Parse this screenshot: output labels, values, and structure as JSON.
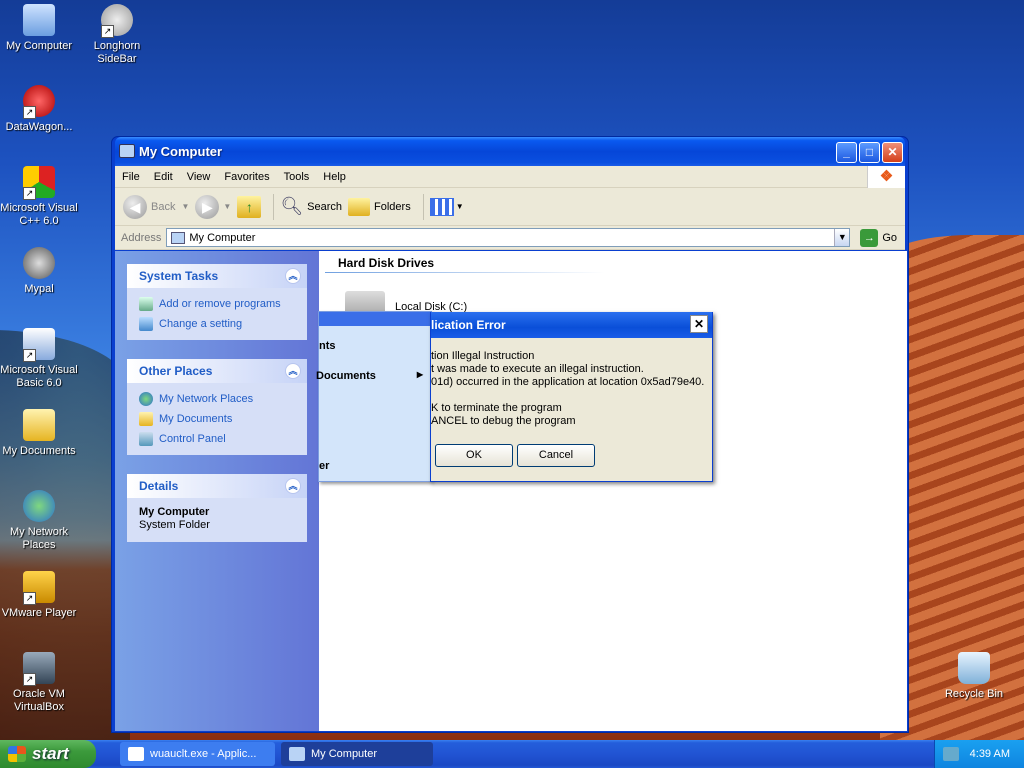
{
  "desktop": {
    "icons": [
      {
        "label": "My Computer",
        "icon": "computer-icon"
      },
      {
        "label": "Longhorn SideBar",
        "icon": "sidebar-icon"
      },
      {
        "label": "DataWagon...",
        "icon": "datawagon-icon"
      },
      {
        "label": "Microsoft Visual C++ 6.0",
        "icon": "visual-cpp-icon"
      },
      {
        "label": "Mypal",
        "icon": "mypal-icon"
      },
      {
        "label": "Microsoft Visual Basic 6.0",
        "icon": "visual-basic-icon"
      },
      {
        "label": "My Documents",
        "icon": "documents-folder-icon"
      },
      {
        "label": "My Network Places",
        "icon": "network-places-icon"
      },
      {
        "label": "VMware Player",
        "icon": "vmware-icon"
      },
      {
        "label": "Oracle VM VirtualBox",
        "icon": "virtualbox-icon"
      },
      {
        "label": "Recycle Bin",
        "icon": "recycle-bin-icon"
      }
    ]
  },
  "window": {
    "title": "My Computer",
    "menu": [
      "File",
      "Edit",
      "View",
      "Favorites",
      "Tools",
      "Help"
    ],
    "toolbar": {
      "back": "Back",
      "search": "Search",
      "folders": "Folders"
    },
    "address": {
      "label": "Address",
      "value": "My Computer",
      "go": "Go"
    },
    "tasks": {
      "system_title": "System Tasks",
      "system_items": [
        "Add or remove programs",
        "Change a setting"
      ],
      "other_title": "Other Places",
      "other_items": [
        "My Network Places",
        "My Documents",
        "Control Panel"
      ],
      "details_title": "Details",
      "details_name": "My Computer",
      "details_type": "System Folder"
    },
    "main": {
      "section": "Hard Disk Drives",
      "drive_label": "Local Disk (C:)"
    }
  },
  "submenu": {
    "items": [
      "nts",
      "Documents",
      "er"
    ]
  },
  "dialog": {
    "title": "lication Error",
    "lines": [
      "tion Illegal Instruction",
      "t was made to execute an illegal instruction.",
      "01d) occurred in the application at location 0x5ad79e40.",
      "K to terminate the program",
      "ANCEL to debug the program"
    ],
    "ok": "OK",
    "cancel": "Cancel"
  },
  "taskbar": {
    "start": "start",
    "tasks": [
      "wuauclt.exe - Applic...",
      "My Computer"
    ],
    "clock": "4:39 AM"
  },
  "colors": {
    "titlebar": "#0a4fe0",
    "taskpane": "#6f8fe0",
    "start": "#3c9a3c"
  }
}
